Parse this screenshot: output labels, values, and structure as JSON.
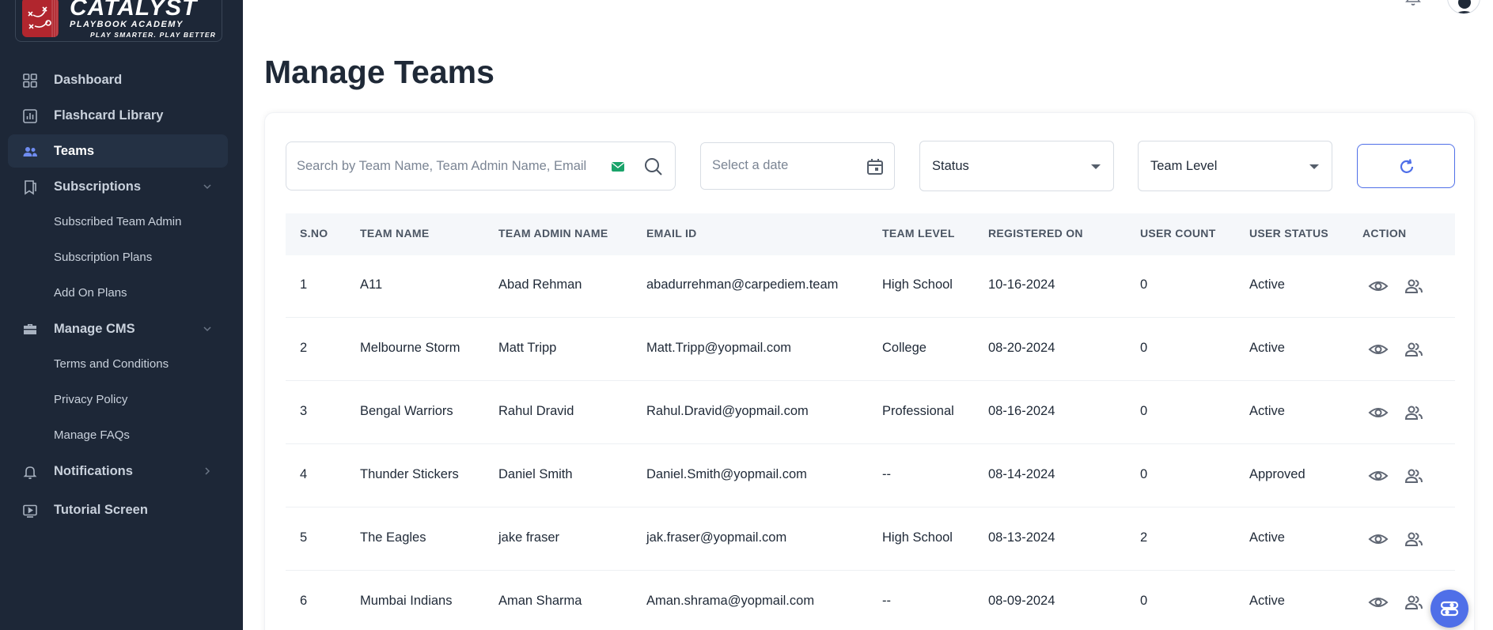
{
  "brand": {
    "title": "CATALYST",
    "subtitle": "PLAYBOOK ACADEMY",
    "tagline": "PLAY SMARTER. PLAY BETTER"
  },
  "sidebar": {
    "items": [
      {
        "label": "Dashboard",
        "icon": "grid-icon"
      },
      {
        "label": "Flashcard Library",
        "icon": "bar-chart-icon"
      },
      {
        "label": "Teams",
        "icon": "users-icon",
        "active": true
      },
      {
        "label": "Subscriptions",
        "icon": "receipt-icon"
      },
      {
        "label": "Subscribed Team Admin"
      },
      {
        "label": "Subscription Plans"
      },
      {
        "label": "Add On Plans"
      },
      {
        "label": "Manage CMS",
        "icon": "briefcase-icon"
      },
      {
        "label": "Terms and Conditions"
      },
      {
        "label": "Privacy Policy"
      },
      {
        "label": "Manage FAQs"
      },
      {
        "label": "Notifications",
        "icon": "bell-icon"
      },
      {
        "label": "Tutorial Screen",
        "icon": "video-icon"
      }
    ]
  },
  "page": {
    "title": "Manage Teams"
  },
  "filters": {
    "search_placeholder": "Search by Team Name, Team Admin Name, Email",
    "date_placeholder": "Select a date",
    "status_label": "Status",
    "team_level_label": "Team Level"
  },
  "table": {
    "headers": [
      "S.NO",
      "TEAM NAME",
      "TEAM ADMIN NAME",
      "EMAIL ID",
      "TEAM LEVEL",
      "REGISTERED ON",
      "USER COUNT",
      "USER STATUS",
      "ACTION"
    ],
    "rows": [
      {
        "sno": "1",
        "team": "A11",
        "admin": "Abad Rehman",
        "email": "abadurrehman@carpediem.team",
        "level": "High School",
        "registered": "10-16-2024",
        "count": "0",
        "status": "Active"
      },
      {
        "sno": "2",
        "team": "Melbourne Storm",
        "admin": "Matt Tripp",
        "email": "Matt.Tripp@yopmail.com",
        "level": "College",
        "registered": "08-20-2024",
        "count": "0",
        "status": "Active"
      },
      {
        "sno": "3",
        "team": "Bengal Warriors",
        "admin": "Rahul Dravid",
        "email": "Rahul.Dravid@yopmail.com",
        "level": "Professional",
        "registered": "08-16-2024",
        "count": "0",
        "status": "Active"
      },
      {
        "sno": "4",
        "team": "Thunder Stickers",
        "admin": "Daniel Smith",
        "email": "Daniel.Smith@yopmail.com",
        "level": "--",
        "registered": "08-14-2024",
        "count": "0",
        "status": "Approved"
      },
      {
        "sno": "5",
        "team": "The Eagles",
        "admin": "jake fraser",
        "email": "jak.fraser@yopmail.com",
        "level": "High School",
        "registered": "08-13-2024",
        "count": "2",
        "status": "Active"
      },
      {
        "sno": "6",
        "team": "Mumbai Indians",
        "admin": "Aman Sharma",
        "email": "Aman.shrama@yopmail.com",
        "level": "--",
        "registered": "08-09-2024",
        "count": "0",
        "status": "Active"
      }
    ]
  },
  "colors": {
    "sidebar_bg": "#1d2737",
    "accent": "#4f6fe8",
    "brand_red": "#b1262e"
  }
}
